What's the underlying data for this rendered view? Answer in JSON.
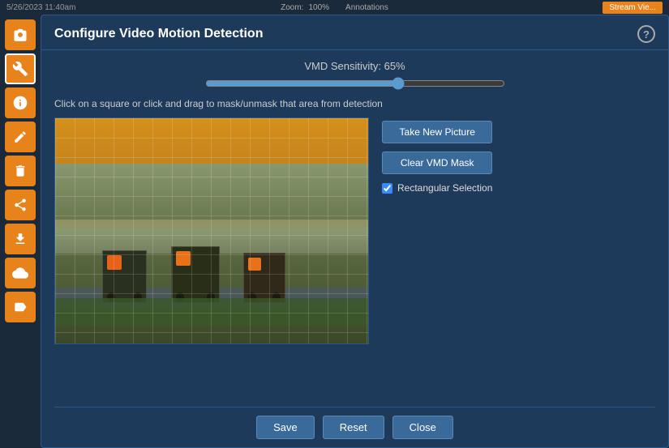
{
  "topbar": {
    "timestamp": "5/26/2023 11:40am",
    "zoom_label": "Zoom:",
    "zoom_value": "100%",
    "annotations_label": "Annotations",
    "stream_btn": "Stream Vie..."
  },
  "sidebar": {
    "items": [
      {
        "id": "camera",
        "icon": "📷",
        "label": "camera-icon"
      },
      {
        "id": "tools",
        "icon": "🔧",
        "label": "tools-icon"
      },
      {
        "id": "info",
        "icon": "ℹ",
        "label": "info-icon"
      },
      {
        "id": "edit",
        "icon": "✏",
        "label": "edit-icon"
      },
      {
        "id": "delete",
        "icon": "🗑",
        "label": "delete-icon"
      },
      {
        "id": "share",
        "icon": "↗",
        "label": "share-icon"
      },
      {
        "id": "export",
        "icon": "↗",
        "label": "export-icon"
      },
      {
        "id": "cloud",
        "icon": "☁",
        "label": "cloud-icon"
      },
      {
        "id": "tag",
        "icon": "🏷",
        "label": "tag-icon"
      }
    ]
  },
  "dialog": {
    "title": "Configure Video Motion Detection",
    "help_label": "?",
    "slider": {
      "label": "VMD Sensitivity: 65%",
      "value": 65,
      "min": 0,
      "max": 100
    },
    "instruction": "Click on a square or click and drag to mask/unmask that area from detection",
    "take_new_picture_btn": "Take New Picture",
    "clear_vmd_mask_btn": "Clear VMD Mask",
    "rectangular_selection_label": "Rectangular Selection",
    "rectangular_selection_checked": true,
    "footer": {
      "save_btn": "Save",
      "reset_btn": "Reset",
      "close_btn": "Close"
    }
  },
  "colors": {
    "accent_orange": "#e8821a",
    "dialog_bg": "#1e3a5a",
    "border": "#2a5a8a",
    "btn_blue": "#3a6a9a"
  }
}
